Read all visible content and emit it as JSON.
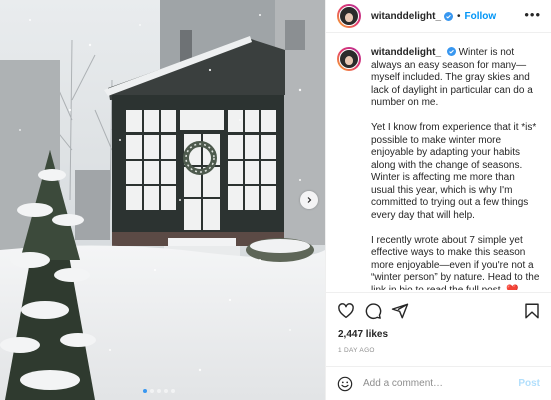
{
  "post": {
    "username": "witanddelight_",
    "separator": "•",
    "follow_label": "Follow",
    "more_label": "•••",
    "caption": [
      "Winter is not always an easy season for many—myself included. The gray skies and lack of daylight in particular can do a number on me.",
      "Yet I know from experience that it *is* possible to make winter more enjoyable by adapting your habits along with the change of seasons. Winter is affecting me more than usual this year, which is why I'm committed to trying out a few things every day that will help.",
      "I recently wrote about 7 simple yet effective ways to make this season more enjoyable—even if you're not a “winter person” by nature. Head to the link in bio to read the full post."
    ],
    "caption_emoji": "❤️",
    "likes": "2,447 likes",
    "time_ago": "1 DAY AGO",
    "comment_placeholder": "Add a comment…",
    "post_label": "Post",
    "carousel": {
      "count": 5,
      "active_index": 0
    }
  },
  "icons": {
    "verified": "verified-badge-icon",
    "like": "heart-icon",
    "comment": "comment-bubble-icon",
    "share": "paper-plane-icon",
    "save": "bookmark-icon",
    "emoji": "smiley-face-icon",
    "next": "chevron-right-icon"
  },
  "colors": {
    "link_blue": "#0095f6",
    "post_disabled": "#b2dffc",
    "muted_text": "#8e8e8e",
    "border": "#efefef",
    "carousel_active": "#3897f0"
  }
}
